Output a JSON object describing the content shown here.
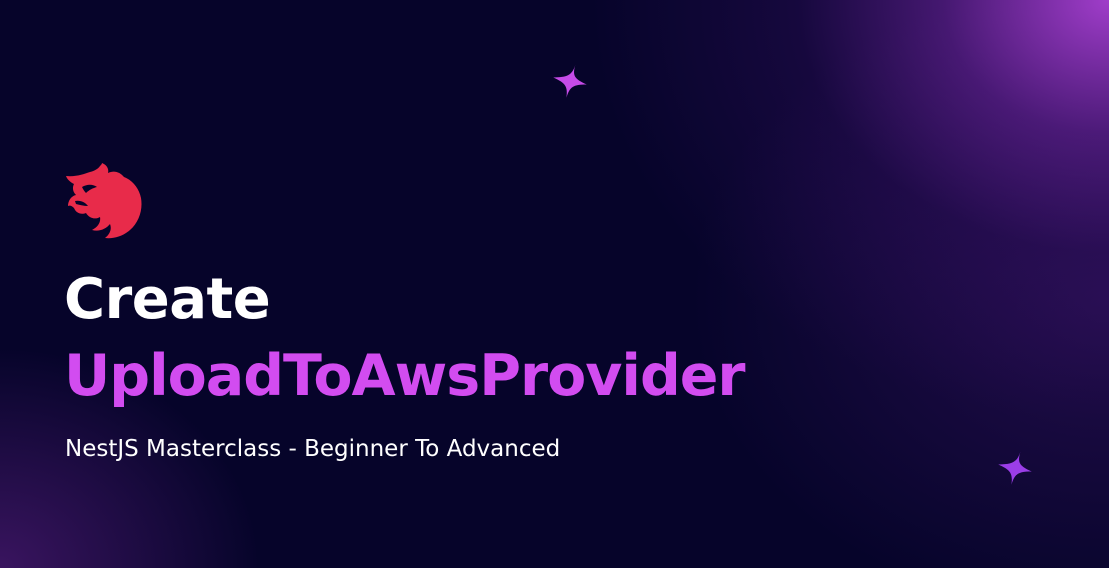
{
  "hero": {
    "logo_icon": "nestjs-cat-logo-icon",
    "title_line1": "Create",
    "title_line2": "UploadToAwsProvider",
    "subtitle": "NestJS Masterclass - Beginner To Advanced"
  },
  "decorations": {
    "sparkle_icon": "four-point-star-icon"
  },
  "colors": {
    "background": "#06042a",
    "accent": "#d24cf0",
    "logo": "#e82b4a",
    "glow": "#a840d2",
    "text": "#ffffff"
  }
}
